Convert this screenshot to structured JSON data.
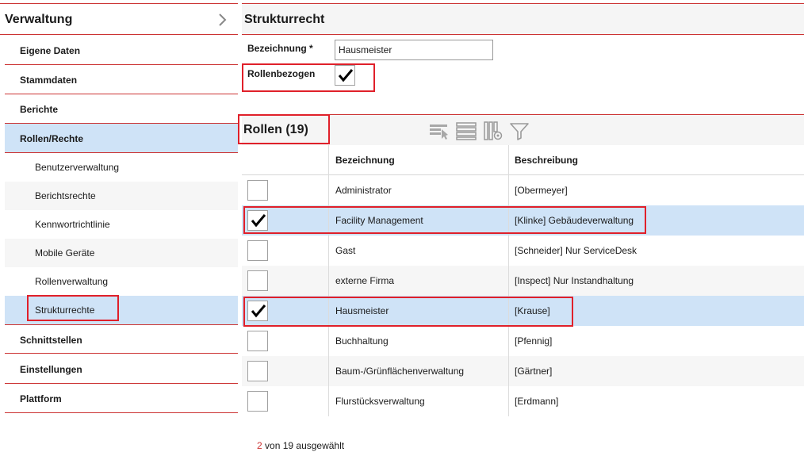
{
  "sidebar": {
    "title": "Verwaltung",
    "items": [
      {
        "label": "Eigene Daten"
      },
      {
        "label": "Stammdaten"
      },
      {
        "label": "Berichte"
      },
      {
        "label": "Rollen/Rechte"
      }
    ],
    "subitems": [
      {
        "label": "Benutzerverwaltung"
      },
      {
        "label": "Berichtsrechte"
      },
      {
        "label": "Kennwortrichtlinie"
      },
      {
        "label": "Mobile Geräte"
      },
      {
        "label": "Rollenverwaltung"
      },
      {
        "label": "Strukturrechte"
      }
    ],
    "items_after": [
      {
        "label": "Schnittstellen"
      },
      {
        "label": "Einstellungen"
      },
      {
        "label": "Plattform"
      }
    ],
    "active_item": "Rollen/Rechte",
    "active_subitem": "Strukturrechte"
  },
  "main": {
    "title": "Strukturrecht",
    "form": {
      "bezeichnung_label": "Bezeichnung *",
      "bezeichnung_value": "Hausmeister",
      "rollenbezogen_label": "Rollenbezogen",
      "rollenbezogen_checked": true
    },
    "rollen": {
      "title": "Rollen (19)",
      "toolbar_icons": [
        "select-filter-icon",
        "list-view-icon",
        "column-settings-icon",
        "filter-icon"
      ],
      "columns": [
        "Bezeichnung",
        "Beschreibung"
      ],
      "rows": [
        {
          "checked": false,
          "bezeichnung": "Administrator",
          "beschreibung": "[Obermeyer]"
        },
        {
          "checked": true,
          "bezeichnung": "Facility Management",
          "beschreibung": "[Klinke] Gebäudeverwaltung"
        },
        {
          "checked": false,
          "bezeichnung": "Gast",
          "beschreibung": "[Schneider] Nur ServiceDesk"
        },
        {
          "checked": false,
          "bezeichnung": "externe Firma",
          "beschreibung": "[Inspect] Nur Instandhaltung"
        },
        {
          "checked": true,
          "bezeichnung": "Hausmeister",
          "beschreibung": "[Krause]"
        },
        {
          "checked": false,
          "bezeichnung": "Buchhaltung",
          "beschreibung": "[Pfennig]"
        },
        {
          "checked": false,
          "bezeichnung": "Baum-/Grünflächenverwaltung",
          "beschreibung": "[Gärtner]"
        },
        {
          "checked": false,
          "bezeichnung": "Flurstücksverwaltung",
          "beschreibung": "[Erdmann]"
        }
      ]
    },
    "footer": {
      "selected_count": "2",
      "selected_text": "von 19 ausgewählt"
    }
  },
  "colors": {
    "accent_red": "#cc3333",
    "selection_blue": "#cfe3f7",
    "highlight_red": "#e0202a"
  }
}
